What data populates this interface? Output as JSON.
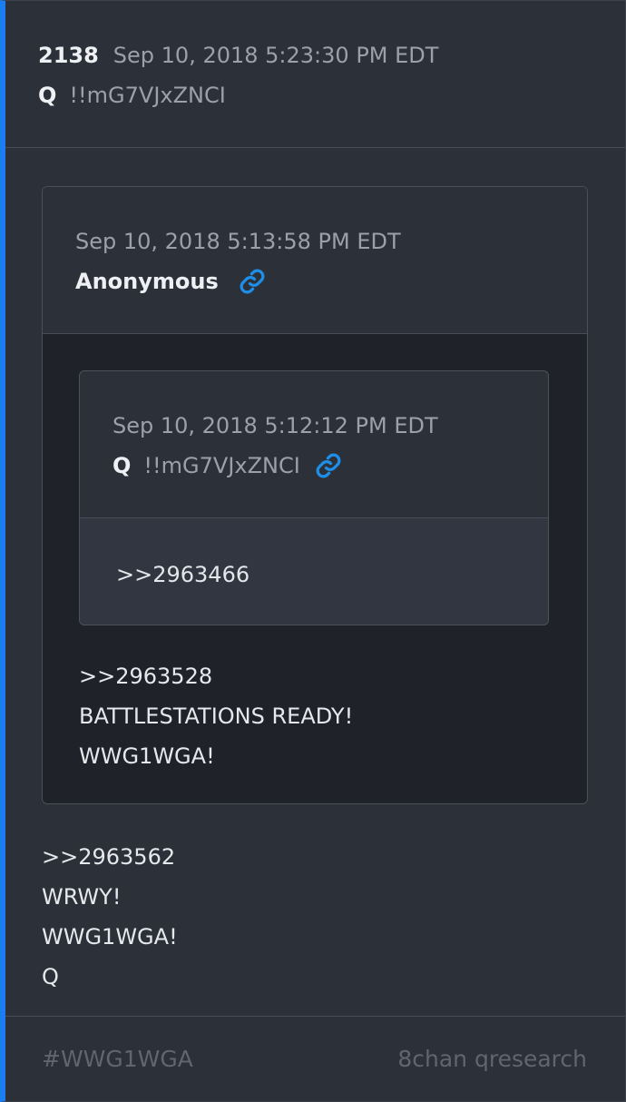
{
  "post": {
    "number": "2138",
    "date": "Sep 10, 2018 5:23:30 PM EDT",
    "author": "Q",
    "tripcode": "!!mG7VJxZNCI",
    "lines": [
      ">>2963562",
      "WRWY!",
      "WWG1WGA!",
      "Q"
    ]
  },
  "quote1": {
    "date": "Sep 10, 2018 5:13:58 PM EDT",
    "author": "Anonymous",
    "lines": [
      ">>2963528",
      "BATTLESTATIONS READY!",
      "WWG1WGA!"
    ]
  },
  "quote2": {
    "date": "Sep 10, 2018 5:12:12 PM EDT",
    "author": "Q",
    "tripcode": "!!mG7VJxZNCI",
    "lines": [
      ">>2963466"
    ]
  },
  "footer": {
    "hashtag": "#WWG1WGA",
    "source": "8chan qresearch"
  },
  "colors": {
    "accent": "#1a7ef2",
    "link_icon": "#1f8ee8"
  },
  "icons": [
    "link-icon"
  ]
}
